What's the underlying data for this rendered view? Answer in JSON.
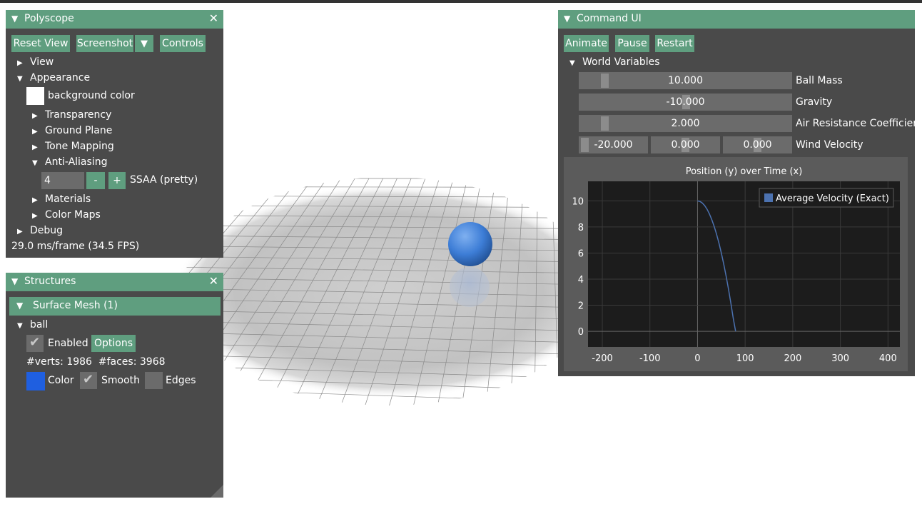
{
  "polyscope": {
    "title": "Polyscope",
    "buttons": {
      "reset_view": "Reset View",
      "screenshot": "Screenshot",
      "controls": "Controls"
    },
    "tree": {
      "view": "View",
      "appearance": "Appearance",
      "background_color": "background color",
      "transparency": "Transparency",
      "ground_plane": "Ground Plane",
      "tone_mapping": "Tone Mapping",
      "anti_aliasing": "Anti-Aliasing",
      "ssaa_value": "4",
      "ssaa_minus": "-",
      "ssaa_plus": "+",
      "ssaa_label": "SSAA (pretty)",
      "materials": "Materials",
      "color_maps": "Color Maps",
      "debug": "Debug"
    },
    "fps": "29.0 ms/frame (34.5 FPS)"
  },
  "structures": {
    "title": "Structures",
    "surface_mesh": "Surface Mesh (1)",
    "ball": "ball",
    "enabled": "Enabled",
    "options": "Options",
    "stats": "#verts: 1986  #faces: 3968",
    "color": "Color",
    "smooth": "Smooth",
    "edges": "Edges"
  },
  "command": {
    "title": "Command UI",
    "animate": "Animate",
    "pause": "Pause",
    "restart": "Restart",
    "world_variables": "World Variables",
    "ball_mass": {
      "label": "Ball Mass",
      "value": "10.000"
    },
    "gravity": {
      "label": "Gravity",
      "value": "-10.000"
    },
    "air_resistance": {
      "label": "Air Resistance Coefficien",
      "value": "2.000"
    },
    "wind": {
      "label": "Wind Velocity",
      "x": "-20.000",
      "y": "0.000",
      "z": "0.000"
    }
  },
  "colors": {
    "accent": "#5f9e7f",
    "panel": "#4a4a4a",
    "ball": "#3d7dd6",
    "mesh_color_swatch": "#1f5fe0",
    "series_color": "#4c72b0"
  },
  "chart_data": {
    "type": "line",
    "title": "Position (y) over Time (x)",
    "xlim": [
      -230,
      425
    ],
    "ylim": [
      -1.2,
      11.5
    ],
    "xticks": [
      -200,
      -100,
      0,
      100,
      200,
      300,
      400
    ],
    "yticks": [
      0,
      2,
      4,
      6,
      8,
      10
    ],
    "legend_position": "top-right",
    "series": [
      {
        "name": "Average Velocity (Exact)",
        "x": [
          0,
          5,
          10,
          15,
          20,
          25,
          30,
          35,
          40,
          45,
          50,
          55,
          60,
          65,
          70,
          75,
          80
        ],
        "y": [
          10.0,
          9.96,
          9.84,
          9.64,
          9.36,
          9.0,
          8.56,
          8.04,
          7.44,
          6.76,
          6.0,
          5.16,
          4.24,
          3.24,
          2.16,
          1.0,
          0.0
        ]
      }
    ]
  }
}
